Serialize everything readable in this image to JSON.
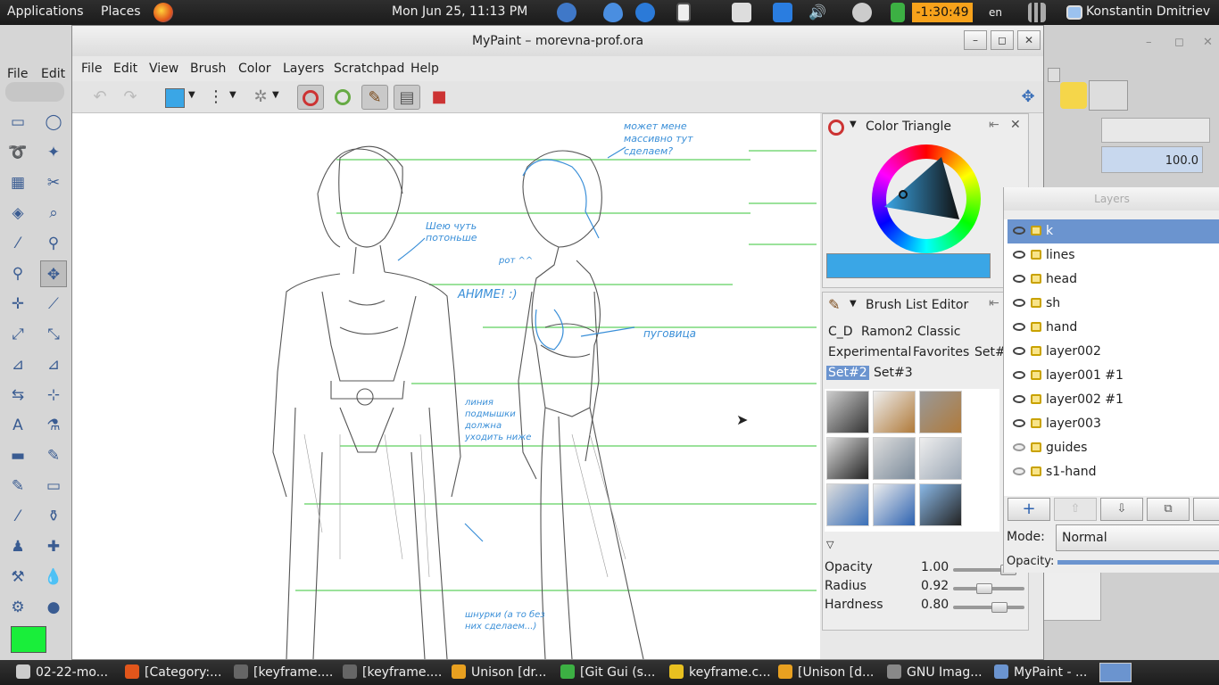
{
  "top_panel": {
    "applications": "Applications",
    "places": "Places",
    "clock": "Mon Jun 25, 11:13 PM",
    "timer": "-1:30:49",
    "keyboard_layout": "en",
    "user": "Konstantin Dmitriev"
  },
  "gimp": {
    "menu": [
      "File",
      "Edit"
    ],
    "opacity_value": "100.0",
    "layers_title": "Layers",
    "mode_label": "Mode:",
    "mode_value": "Normal",
    "opacity_label": "Opacity:",
    "layers": [
      {
        "name": "k",
        "visible": true,
        "selected": true
      },
      {
        "name": "lines",
        "visible": true
      },
      {
        "name": "head",
        "visible": true
      },
      {
        "name": "sh",
        "visible": true
      },
      {
        "name": "hand",
        "visible": true
      },
      {
        "name": "layer002",
        "visible": true
      },
      {
        "name": "layer001 #1",
        "visible": true
      },
      {
        "name": "layer002 #1",
        "visible": true
      },
      {
        "name": "layer003",
        "visible": true
      },
      {
        "name": "guides",
        "visible": false
      },
      {
        "name": "s1-hand",
        "visible": false
      }
    ],
    "fg_color": "#19ee3a"
  },
  "mypaint": {
    "title": "MyPaint – morevna-prof.ora",
    "menu": [
      "File",
      "Edit",
      "View",
      "Brush",
      "Color",
      "Layers",
      "Scratchpad",
      "Help"
    ],
    "current_color": "#3aa6e6",
    "color_panel_title": "Color Triangle",
    "brush_panel_title": "Brush List Editor",
    "brush_groups": [
      "C_D",
      "Ramon2",
      "Classic",
      "Experimental",
      "Favorites",
      "Set#",
      "Set#2",
      "Set#3"
    ],
    "active_group": "Set#2",
    "sliders": [
      {
        "label": "Opacity",
        "value": "1.00",
        "fraction": 0.85
      },
      {
        "label": "Radius",
        "value": "0.92",
        "fraction": 0.42
      },
      {
        "label": "Hardness",
        "value": "0.80",
        "fraction": 0.7
      }
    ],
    "annotations": [
      "может мене массивно тут сделаем?",
      "Шею чуть потоньше",
      "рот ^^",
      "АНИМЕ! :)",
      "пуговица",
      "линия подмышки должна уходить ниже",
      "шнурки (а то без них сделаем...)"
    ]
  },
  "taskbar": {
    "tasks": [
      "02-22-mo...",
      "[Category:...",
      "[keyframe....",
      "[keyframe....",
      "Unison [dr...",
      "[Git Gui (s...",
      "keyframe.c...",
      "[Unison [d...",
      "GNU Imag...",
      "MyPaint - ..."
    ]
  },
  "colors": {
    "selection": "#6b94cf",
    "guide_line": "#9be29b",
    "annotation_ink": "#3a8fd8",
    "timer_bg": "#f7a21b"
  }
}
